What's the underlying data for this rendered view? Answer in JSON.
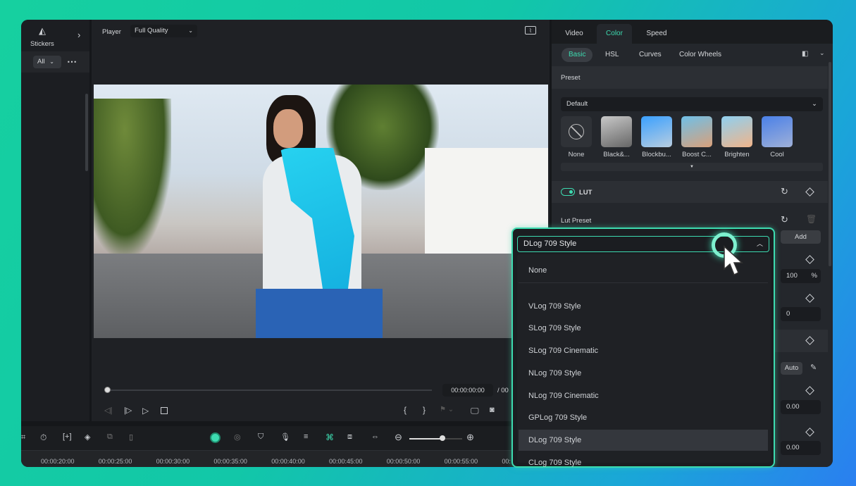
{
  "left_panel": {
    "stickers_label": "Stickers",
    "filter": "All",
    "more": "⋯"
  },
  "player": {
    "label": "Player",
    "quality": "Full Quality",
    "current_time": "00:00:00:00",
    "total_time_partial": "/  00"
  },
  "right_panel": {
    "tabs": [
      {
        "label": "Video"
      },
      {
        "label": "Color",
        "active": true
      },
      {
        "label": "Speed"
      }
    ],
    "subtabs": [
      {
        "label": "Basic",
        "active": true
      },
      {
        "label": "HSL"
      },
      {
        "label": "Curves"
      },
      {
        "label": "Color Wheels"
      }
    ],
    "preset_header": "Preset",
    "preset_select": "Default",
    "presets": [
      {
        "label": "None"
      },
      {
        "label": "Black&..."
      },
      {
        "label": "Blockbu..."
      },
      {
        "label": "Boost C..."
      },
      {
        "label": "Brighten"
      },
      {
        "label": "Cool"
      }
    ],
    "lut_label": "LUT",
    "lut_enabled": true,
    "lut_preset_label": "Lut Preset",
    "add_label": "Add",
    "strength_value": "100",
    "strength_unit": "%",
    "value2": "0",
    "auto_label": "Auto",
    "value3": "0.00",
    "value4": "0.00"
  },
  "lut_dropdown": {
    "selected": "DLog 709 Style",
    "options": [
      "None",
      "VLog 709 Style",
      "SLog 709 Style",
      "SLog 709 Cinematic",
      "NLog 709 Style",
      "NLog 709 Cinematic",
      "GPLog 709 Style",
      "DLog 709 Style",
      "CLog 709 Style"
    ]
  },
  "timeline": {
    "ticks": [
      "00:00:20:00",
      "00:00:25:00",
      "00:00:30:00",
      "00:00:35:00",
      "00:00:40:00",
      "00:00:45:00",
      "00:00:50:00",
      "00:00:55:00",
      "00:"
    ],
    "zoom_level": 0.62
  },
  "colors": {
    "accent": "#3ddbb0",
    "panel": "#24272c",
    "background": "#15171a"
  }
}
